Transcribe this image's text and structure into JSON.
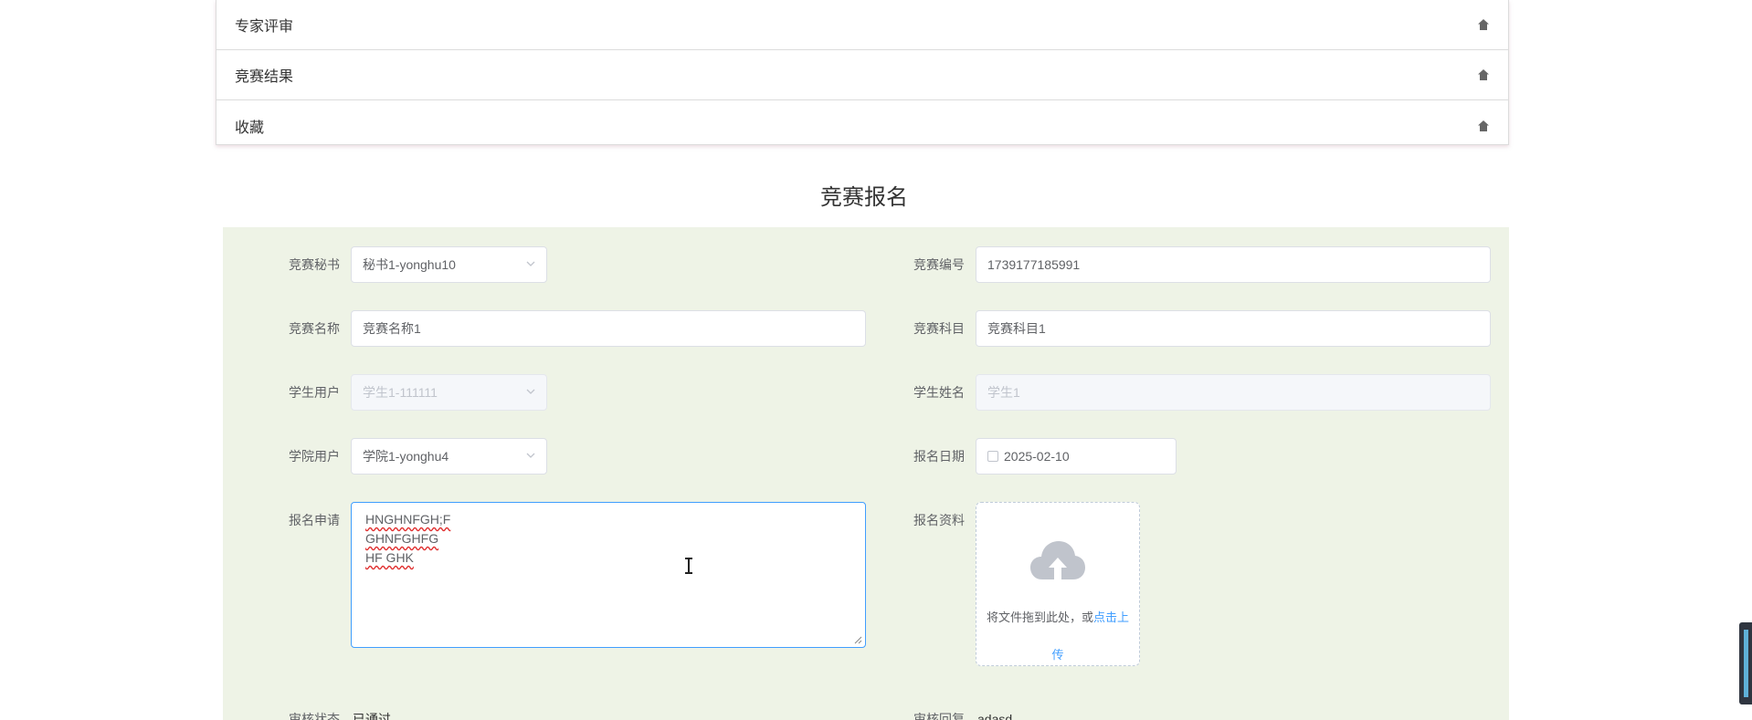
{
  "menu": {
    "items": [
      {
        "label": "专家评审"
      },
      {
        "label": "竞赛结果"
      },
      {
        "label": "收藏"
      }
    ]
  },
  "page": {
    "title": "竞赛报名"
  },
  "form": {
    "secretary": {
      "label": "竞赛秘书",
      "value": "秘书1-yonghu10"
    },
    "number": {
      "label": "竞赛编号",
      "value": "1739177185991"
    },
    "name": {
      "label": "竞赛名称",
      "value": "竞赛名称1"
    },
    "subject": {
      "label": "竞赛科目",
      "value": "竞赛科目1"
    },
    "student_user": {
      "label": "学生用户",
      "value": "学生1-111111"
    },
    "student_name": {
      "label": "学生姓名",
      "value": "学生1"
    },
    "college_user": {
      "label": "学院用户",
      "value": "学院1-yonghu4"
    },
    "date": {
      "label": "报名日期",
      "value": "2025-02-10"
    },
    "application": {
      "label": "报名申请",
      "lines": [
        "HNGHNFGH;F",
        "GHNFGHFG",
        "HF GHK"
      ]
    },
    "material": {
      "label": "报名资料",
      "hint": "将文件拖到此处，或",
      "link": "点击上",
      "link2": "传"
    },
    "review_status": {
      "label": "审核状态",
      "value": "已通过"
    },
    "review_reply": {
      "label": "审核回复",
      "value": "adasd"
    }
  },
  "colors": {
    "panel_bg": "#eef3e6",
    "accent": "#409eff",
    "border": "#dcdfe6"
  }
}
